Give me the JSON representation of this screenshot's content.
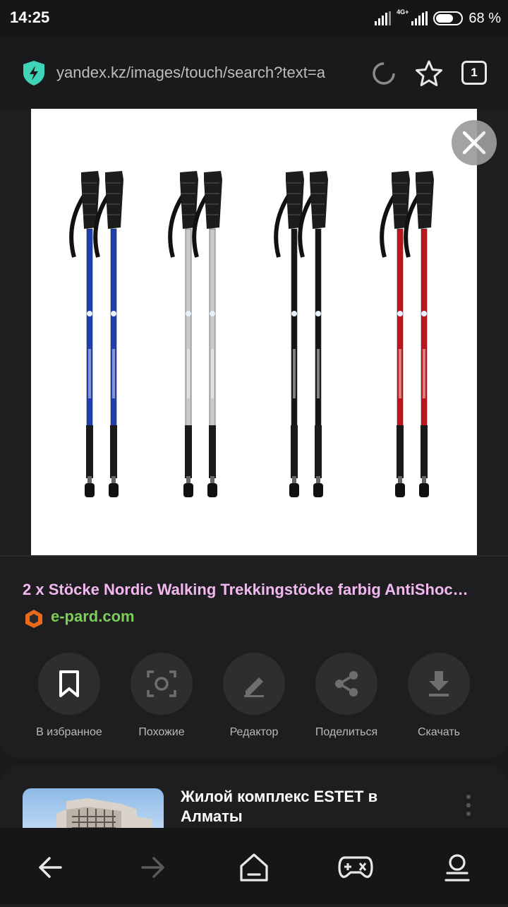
{
  "status_bar": {
    "time": "14:25",
    "network": "4G+",
    "battery_percent": "68 %",
    "battery_level": 0.68
  },
  "browser": {
    "url": "yandex.kz/images/touch/search?text=a",
    "tab_count": "1",
    "shield_color": "#3fd4b7",
    "icons": [
      "shield-icon",
      "reload-icon",
      "star-icon",
      "tabs-icon"
    ]
  },
  "image_result": {
    "title": "2 x Stöcke Nordic Walking Trekkingstöcke farbig AntiShoc…",
    "site": "e-pard.com",
    "title_color": "#f2b8f0",
    "site_color": "#7ccf55",
    "pole_colors": [
      "#1f3fb0",
      "#c8c8cc",
      "#151515",
      "#c0141c"
    ]
  },
  "actions": [
    {
      "label": "В избранное",
      "icon": "bookmark-icon"
    },
    {
      "label": "Похожие",
      "icon": "similar-search-icon"
    },
    {
      "label": "Редактор",
      "icon": "pencil-icon"
    },
    {
      "label": "Поделиться",
      "icon": "share-icon"
    },
    {
      "label": "Скачать",
      "icon": "download-icon"
    }
  ],
  "related": {
    "title": "Жилой комплекс ESTET в Алматы"
  },
  "nav": [
    "back-icon",
    "forward-icon",
    "home-icon",
    "games-icon",
    "profile-icon"
  ]
}
